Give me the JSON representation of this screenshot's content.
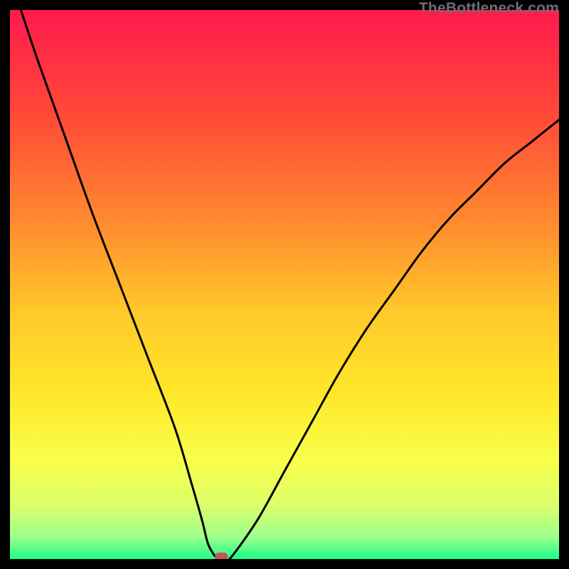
{
  "watermark": "TheBottleneck.com",
  "chart_data": {
    "type": "line",
    "title": "",
    "xlabel": "",
    "ylabel": "",
    "xlim": [
      0,
      100
    ],
    "ylim": [
      0,
      100
    ],
    "series": [
      {
        "name": "bottleneck-curve",
        "x": [
          2,
          5,
          10,
          15,
          20,
          25,
          30,
          33,
          35,
          36,
          37,
          38,
          39,
          40,
          45,
          50,
          55,
          60,
          65,
          70,
          75,
          80,
          85,
          90,
          95,
          100
        ],
        "values": [
          100,
          91,
          77,
          63,
          50,
          37,
          24,
          14,
          7,
          3,
          1,
          0,
          0,
          0,
          7,
          16,
          25,
          34,
          42,
          49,
          56,
          62,
          67,
          72,
          76,
          80
        ]
      }
    ],
    "minimum_marker": {
      "x": 38.5,
      "y": 0
    },
    "gradient_stops": [
      {
        "offset": 0.0,
        "color": "#ff1a4d"
      },
      {
        "offset": 0.2,
        "color": "#ff4c37"
      },
      {
        "offset": 0.4,
        "color": "#ff8f2e"
      },
      {
        "offset": 0.55,
        "color": "#ffc82a"
      },
      {
        "offset": 0.7,
        "color": "#ffe72a"
      },
      {
        "offset": 0.82,
        "color": "#f8ff4a"
      },
      {
        "offset": 0.9,
        "color": "#deff6a"
      },
      {
        "offset": 0.96,
        "color": "#9dff8a"
      },
      {
        "offset": 1.0,
        "color": "#1aff8a"
      }
    ]
  }
}
